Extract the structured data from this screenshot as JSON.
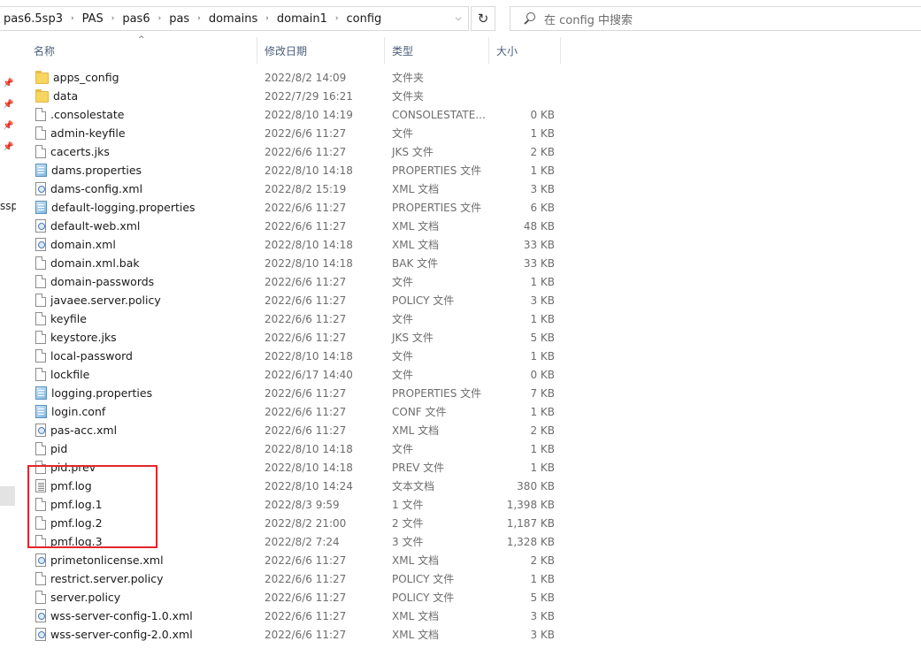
{
  "address": {
    "crumbs": [
      "pas6.5sp3",
      "PAS",
      "pas6",
      "pas",
      "domains",
      "domain1",
      "config"
    ],
    "separator": "›",
    "dropdown_glyph": "⌵",
    "refresh_glyph": "↻"
  },
  "search": {
    "placeholder": "在 config 中搜索"
  },
  "nav": {
    "cut_text": "ssp",
    "pin_glyph": "📌"
  },
  "columns": {
    "name": "名称",
    "date": "修改日期",
    "type": "类型",
    "size": "大小",
    "sort_glyph": "^"
  },
  "files": [
    {
      "name": "apps_config",
      "date": "2022/8/2 14:09",
      "type": "文件夹",
      "size": "",
      "icon": "folder-icon"
    },
    {
      "name": "data",
      "date": "2022/7/29 16:21",
      "type": "文件夹",
      "size": "",
      "icon": "folder-icon"
    },
    {
      "name": ".consolestate",
      "date": "2022/8/10 14:19",
      "type": "CONSOLESTATE...",
      "size": "0 KB",
      "icon": "file-icon"
    },
    {
      "name": "admin-keyfile",
      "date": "2022/6/6 11:27",
      "type": "文件",
      "size": "1 KB",
      "icon": "file-icon"
    },
    {
      "name": "cacerts.jks",
      "date": "2022/6/6 11:27",
      "type": "JKS 文件",
      "size": "2 KB",
      "icon": "file-icon"
    },
    {
      "name": "dams.properties",
      "date": "2022/8/10 14:18",
      "type": "PROPERTIES 文件",
      "size": "1 KB",
      "icon": "properties-icon"
    },
    {
      "name": "dams-config.xml",
      "date": "2022/8/2 15:19",
      "type": "XML 文档",
      "size": "3 KB",
      "icon": "xml-icon"
    },
    {
      "name": "default-logging.properties",
      "date": "2022/6/6 11:27",
      "type": "PROPERTIES 文件",
      "size": "6 KB",
      "icon": "properties-icon"
    },
    {
      "name": "default-web.xml",
      "date": "2022/6/6 11:27",
      "type": "XML 文档",
      "size": "48 KB",
      "icon": "xml-icon"
    },
    {
      "name": "domain.xml",
      "date": "2022/8/10 14:18",
      "type": "XML 文档",
      "size": "33 KB",
      "icon": "xml-icon"
    },
    {
      "name": "domain.xml.bak",
      "date": "2022/8/10 14:18",
      "type": "BAK 文件",
      "size": "33 KB",
      "icon": "file-icon"
    },
    {
      "name": "domain-passwords",
      "date": "2022/6/6 11:27",
      "type": "文件",
      "size": "1 KB",
      "icon": "file-icon"
    },
    {
      "name": "javaee.server.policy",
      "date": "2022/6/6 11:27",
      "type": "POLICY 文件",
      "size": "3 KB",
      "icon": "file-icon"
    },
    {
      "name": "keyfile",
      "date": "2022/6/6 11:27",
      "type": "文件",
      "size": "1 KB",
      "icon": "file-icon"
    },
    {
      "name": "keystore.jks",
      "date": "2022/6/6 11:27",
      "type": "JKS 文件",
      "size": "5 KB",
      "icon": "file-icon"
    },
    {
      "name": "local-password",
      "date": "2022/8/10 14:18",
      "type": "文件",
      "size": "1 KB",
      "icon": "file-icon"
    },
    {
      "name": "lockfile",
      "date": "2022/6/17 14:40",
      "type": "文件",
      "size": "0 KB",
      "icon": "file-icon"
    },
    {
      "name": "logging.properties",
      "date": "2022/6/6 11:27",
      "type": "PROPERTIES 文件",
      "size": "7 KB",
      "icon": "properties-icon"
    },
    {
      "name": "login.conf",
      "date": "2022/6/6 11:27",
      "type": "CONF 文件",
      "size": "1 KB",
      "icon": "properties-icon"
    },
    {
      "name": "pas-acc.xml",
      "date": "2022/6/6 11:27",
      "type": "XML 文档",
      "size": "2 KB",
      "icon": "xml-icon"
    },
    {
      "name": "pid",
      "date": "2022/8/10 14:18",
      "type": "文件",
      "size": "1 KB",
      "icon": "file-icon"
    },
    {
      "name": "pid.prev",
      "date": "2022/8/10 14:18",
      "type": "PREV 文件",
      "size": "1 KB",
      "icon": "file-icon"
    },
    {
      "name": "pmf.log",
      "date": "2022/8/10 14:24",
      "type": "文本文档",
      "size": "380 KB",
      "icon": "text-document-icon"
    },
    {
      "name": "pmf.log.1",
      "date": "2022/8/3 9:59",
      "type": "1 文件",
      "size": "1,398 KB",
      "icon": "file-icon"
    },
    {
      "name": "pmf.log.2",
      "date": "2022/8/2 21:00",
      "type": "2 文件",
      "size": "1,187 KB",
      "icon": "file-icon"
    },
    {
      "name": "pmf.log.3",
      "date": "2022/8/2 7:24",
      "type": "3 文件",
      "size": "1,328 KB",
      "icon": "file-icon"
    },
    {
      "name": "primetonlicense.xml",
      "date": "2022/6/6 11:27",
      "type": "XML 文档",
      "size": "2 KB",
      "icon": "xml-icon"
    },
    {
      "name": "restrict.server.policy",
      "date": "2022/6/6 11:27",
      "type": "POLICY 文件",
      "size": "1 KB",
      "icon": "file-icon"
    },
    {
      "name": "server.policy",
      "date": "2022/6/6 11:27",
      "type": "POLICY 文件",
      "size": "5 KB",
      "icon": "file-icon"
    },
    {
      "name": "wss-server-config-1.0.xml",
      "date": "2022/6/6 11:27",
      "type": "XML 文档",
      "size": "3 KB",
      "icon": "xml-icon"
    },
    {
      "name": "wss-server-config-2.0.xml",
      "date": "2022/6/6 11:27",
      "type": "XML 文档",
      "size": "3 KB",
      "icon": "xml-icon"
    }
  ],
  "highlight": {
    "color": "#e3262b"
  }
}
